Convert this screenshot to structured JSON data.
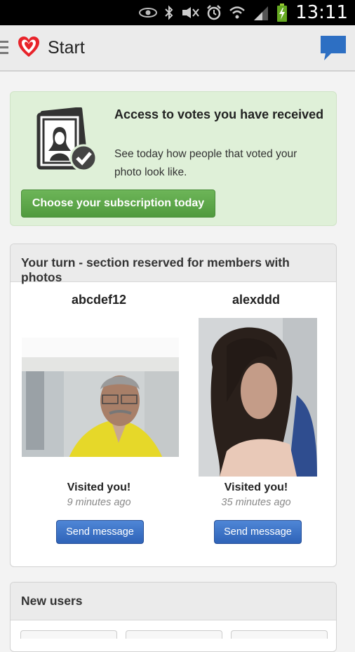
{
  "status_bar": {
    "time": "13:11",
    "icons": [
      "eye-icon",
      "bluetooth-icon",
      "mute-icon",
      "alarm-icon",
      "wifi-icon",
      "signal-icon",
      "battery-charging-icon"
    ]
  },
  "app_bar": {
    "title": "Start"
  },
  "promo": {
    "title": "Access to votes you have received",
    "description": "See today how people that voted your photo look like.",
    "button_label": "Choose your subscription today"
  },
  "your_turn": {
    "header": "Your turn - section reserved for members with photos",
    "members": [
      {
        "username": "abcdef12",
        "status": "Visited you!",
        "time_ago": "9 minutes ago",
        "button_label": "Send message"
      },
      {
        "username": "alexddd",
        "status": "Visited you!",
        "time_ago": "35 minutes ago",
        "button_label": "Send message"
      }
    ]
  },
  "new_users": {
    "header": "New users"
  },
  "colors": {
    "accent_red": "#e8232a",
    "promo_green": "#dff0d8",
    "button_green": "#5aa647",
    "button_blue": "#3b73c9",
    "chat_blue": "#2d6fc3"
  }
}
